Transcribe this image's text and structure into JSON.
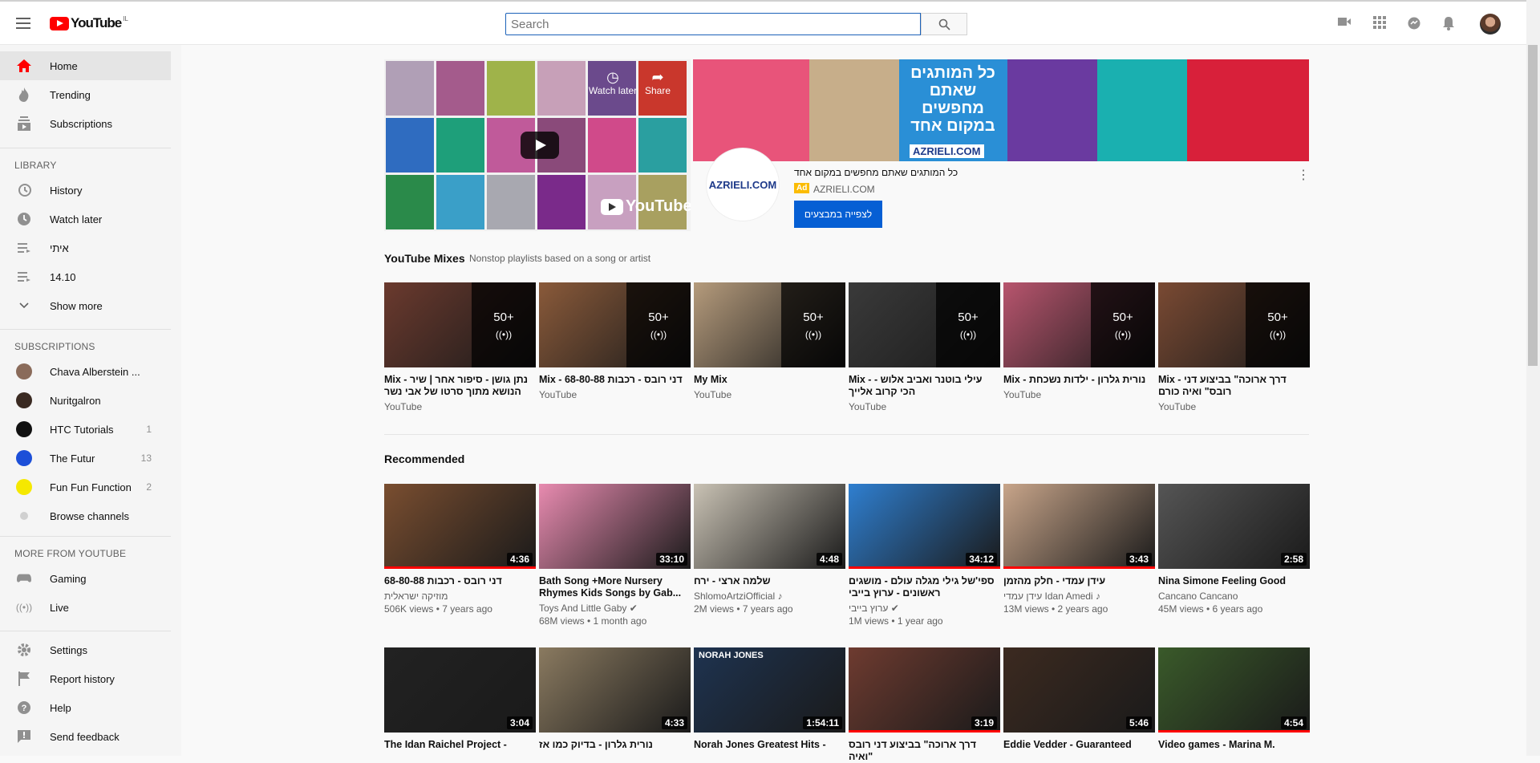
{
  "header": {
    "logo_text": "YouTube",
    "country": "IL",
    "search_placeholder": "Search"
  },
  "sidebar": {
    "main": [
      {
        "label": "Home"
      },
      {
        "label": "Trending"
      },
      {
        "label": "Subscriptions"
      }
    ],
    "library_title": "LIBRARY",
    "library": [
      {
        "label": "History"
      },
      {
        "label": "Watch later"
      },
      {
        "label": "איתי"
      },
      {
        "label": "14.10"
      },
      {
        "label": "Show more"
      }
    ],
    "subscriptions_title": "SUBSCRIPTIONS",
    "subscriptions": [
      {
        "label": "Chava Alberstein ...",
        "count": "",
        "color": "#8a6b5a"
      },
      {
        "label": "Nuritgalron",
        "count": "",
        "color": "#3a2a22"
      },
      {
        "label": "HTC Tutorials",
        "count": "1",
        "color": "#111111"
      },
      {
        "label": "The Futur",
        "count": "13",
        "color": "#1c4fd8"
      },
      {
        "label": "Fun Fun Function",
        "count": "2",
        "color": "#f5e800"
      },
      {
        "label": "Browse channels",
        "count": "",
        "color": "#d0d0d0"
      }
    ],
    "more_title": "MORE FROM YOUTUBE",
    "more": [
      {
        "label": "Gaming"
      },
      {
        "label": "Live"
      }
    ],
    "footer": [
      {
        "label": "Settings"
      },
      {
        "label": "Report history"
      },
      {
        "label": "Help"
      },
      {
        "label": "Send feedback"
      }
    ]
  },
  "ad": {
    "watch_later": "Watch later",
    "share": "Share",
    "yt_logo": "YouTube",
    "banner_text": "כל המותגים שאתם מחפשים במקום אחד",
    "banner_brand": "AZRIELI.COM",
    "logo": "AZRIELI.COM",
    "title": "כל המותגים שאתם מחפשים במקום אחד",
    "badge": "Ad",
    "domain": "AZRIELI.COM",
    "cta": "לצפייה במבצעים"
  },
  "mixes": {
    "title": "YouTube Mixes",
    "subtitle": "Nonstop playlists based on a song or artist",
    "items": [
      {
        "title": "Mix - נתן גושן - סיפור אחר | שיר הנושא מתוך סרטו של אבי נשר",
        "channel": "YouTube",
        "count": "50+",
        "thumb": "#6b3a2e"
      },
      {
        "title": "Mix - 68-80-88 דני רובס - רכבות",
        "channel": "YouTube",
        "count": "50+",
        "thumb": "#8a5a3a"
      },
      {
        "title": "My Mix",
        "channel": "YouTube",
        "count": "50+",
        "thumb": "#b59b7c"
      },
      {
        "title": "Mix - עילי בוטנר ואביב אלוש - הכי קרוב אלייך",
        "channel": "YouTube",
        "count": "50+",
        "thumb": "#3a3a3a"
      },
      {
        "title": "Mix - נורית גלרון - ילדות נשכחת",
        "channel": "YouTube",
        "count": "50+",
        "thumb": "#b8556e"
      },
      {
        "title": "Mix - דרך ארוכה\" בביצוע דני רובס\" ואיה כורם",
        "channel": "YouTube",
        "count": "50+",
        "thumb": "#7a4a33"
      }
    ]
  },
  "recommended": {
    "title": "Recommended",
    "items": [
      {
        "title": "68-80-88 דני רובס - רכבות",
        "channel": "מוזיקה ישראלית",
        "meta": "506K views • 7 years ago",
        "duration": "4:36",
        "progress": 100,
        "thumb": "#7a4e30"
      },
      {
        "title": "Bath Song +More Nursery Rhymes Kids Songs by Gab...",
        "channel": "Toys And Little Gaby ✔",
        "meta": "68M views • 1 month ago",
        "duration": "33:10",
        "progress": 0,
        "thumb": "#e88bb0"
      },
      {
        "title": "שלמה ארצי - ירח",
        "channel": "ShlomoArtziOfficial ♪",
        "meta": "2M views • 7 years ago",
        "duration": "4:48",
        "progress": 0,
        "thumb": "#c9c2b4"
      },
      {
        "title": "ספי'של גילי מגלה עולם - מושגים ראשונים - ערוץ בייבי",
        "channel": "ערוץ בייבי ✔",
        "meta": "1M views • 1 year ago",
        "duration": "34:12",
        "progress": 100,
        "thumb": "#2f7fd0"
      },
      {
        "title": "עידן עמדי - חלק מהזמן",
        "channel": "עידן עמדי Idan Amedi ♪",
        "meta": "13M views • 2 years ago",
        "duration": "3:43",
        "progress": 100,
        "thumb": "#c8a58a"
      },
      {
        "title": "Nina Simone Feeling Good",
        "channel": "Cancano Cancano",
        "meta": "45M views • 6 years ago",
        "duration": "2:58",
        "progress": 0,
        "thumb": "#555555"
      }
    ],
    "row2": [
      {
        "title": "The Idan Raichel Project -",
        "duration": "3:04",
        "progress": 0,
        "thumb": "#222222"
      },
      {
        "title": "נורית גלרון - בדיוק כמו אז",
        "duration": "4:33",
        "progress": 0,
        "thumb": "#8a7a60"
      },
      {
        "title": "Norah Jones Greatest Hits -",
        "duration": "1:54:11",
        "progress": 0,
        "thumb": "#1e3350",
        "label": "NORAH JONES"
      },
      {
        "title": "דרך ארוכה\" בביצוע דני רובס ואיה\"",
        "duration": "3:19",
        "progress": 100,
        "thumb": "#6e3b30"
      },
      {
        "title": "Eddie Vedder - Guaranteed",
        "duration": "5:46",
        "progress": 0,
        "thumb": "#3c2a20"
      },
      {
        "title": "Video games - Marina M.",
        "duration": "4:54",
        "progress": 100,
        "thumb": "#3a5a2a"
      }
    ]
  }
}
